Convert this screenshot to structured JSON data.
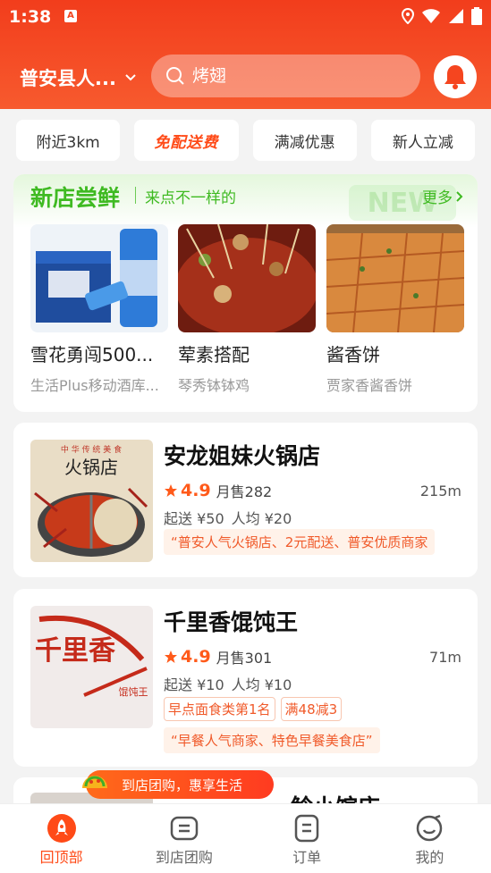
{
  "status_bar": {
    "time": "1:38",
    "badge": "A"
  },
  "header": {
    "location": "普安县人...",
    "search_placeholder": "烤翅"
  },
  "filters": [
    "附近3km",
    "免配送费",
    "满减优惠",
    "新人立减"
  ],
  "new_stores": {
    "title": "新店尝鲜",
    "subtitle": "来点不一样的",
    "more": "更多",
    "bg_text": "NEW",
    "items": [
      {
        "name": "雪花勇闯500...",
        "shop": "生活Plus移动酒库..."
      },
      {
        "name": "荤素搭配",
        "shop": "琴秀钵钵鸡"
      },
      {
        "name": "酱香饼",
        "shop": "贾家香酱香饼"
      }
    ]
  },
  "stores": [
    {
      "name": "安龙姐妹火锅店",
      "rating": "4.9",
      "monthly_sales": "月售282",
      "distance": "215m",
      "min_order": "起送 ¥50",
      "avg_price": "人均 ¥20",
      "tags": [],
      "slogan": "“普安人气火锅店、2元配送、普安优质商家",
      "image_text_top": "中 华 传 统 美 食",
      "image_text_main": "火锅店"
    },
    {
      "name": "千里香馄饨王",
      "rating": "4.9",
      "monthly_sales": "月售301",
      "distance": "71m",
      "min_order": "起送 ¥10",
      "avg_price": "人均 ¥10",
      "tags": [
        "早点面食类第1名",
        "满48减3"
      ],
      "slogan": "“早餐人气商家、特色早餐美食店”",
      "image_text_main": "千里香",
      "image_text_side": "馄饨王"
    },
    {
      "name": "...",
      "partial_name": "鲶小馆店"
    }
  ],
  "promo_banner": "到店团购，惠享生活",
  "tabbar": [
    {
      "label": "回顶部",
      "icon": "rocket-icon",
      "active": true
    },
    {
      "label": "到店团购",
      "icon": "ticket-icon",
      "active": false
    },
    {
      "label": "订单",
      "icon": "order-icon",
      "active": false
    },
    {
      "label": "我的",
      "icon": "profile-icon",
      "active": false
    }
  ],
  "colors": {
    "brand": "#f23d1c",
    "accent_green": "#3fba22",
    "accent_orange": "#ff5a1a"
  }
}
